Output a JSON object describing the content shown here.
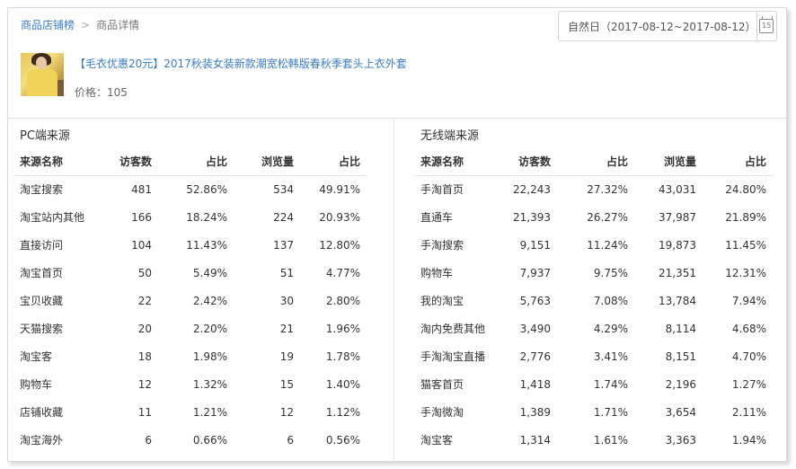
{
  "breadcrumb": {
    "root": "商品店铺榜",
    "separator": ">",
    "current": "商品详情"
  },
  "date_filter": {
    "label": "自然日（2017-08-12~2017-08-12）",
    "icon": "calendar-icon",
    "icon_text": "15"
  },
  "product": {
    "title": "【毛衣优惠20元】2017秋装女装新款潮宽松韩版春秋季套头上衣外套",
    "price": "价格：105"
  },
  "pc": {
    "title": "PC端来源",
    "columns": [
      "来源名称",
      "访客数",
      "占比",
      "浏览量",
      "占比"
    ],
    "rows": [
      [
        "淘宝搜索",
        "481",
        "52.86%",
        "534",
        "49.91%"
      ],
      [
        "淘宝站内其他",
        "166",
        "18.24%",
        "224",
        "20.93%"
      ],
      [
        "直接访问",
        "104",
        "11.43%",
        "137",
        "12.80%"
      ],
      [
        "淘宝首页",
        "50",
        "5.49%",
        "51",
        "4.77%"
      ],
      [
        "宝贝收藏",
        "22",
        "2.42%",
        "30",
        "2.80%"
      ],
      [
        "天猫搜索",
        "20",
        "2.20%",
        "21",
        "1.96%"
      ],
      [
        "淘宝客",
        "18",
        "1.98%",
        "19",
        "1.78%"
      ],
      [
        "购物车",
        "12",
        "1.32%",
        "15",
        "1.40%"
      ],
      [
        "店铺收藏",
        "11",
        "1.21%",
        "12",
        "1.12%"
      ],
      [
        "淘宝海外",
        "6",
        "0.66%",
        "6",
        "0.56%"
      ]
    ]
  },
  "wireless": {
    "title": "无线端来源",
    "columns": [
      "来源名称",
      "访客数",
      "占比",
      "浏览量",
      "占比"
    ],
    "rows": [
      [
        "手淘首页",
        "22,243",
        "27.32%",
        "43,031",
        "24.80%"
      ],
      [
        "直通车",
        "21,393",
        "26.27%",
        "37,987",
        "21.89%"
      ],
      [
        "手淘搜索",
        "9,151",
        "11.24%",
        "19,873",
        "11.45%"
      ],
      [
        "购物车",
        "7,937",
        "9.75%",
        "21,351",
        "12.31%"
      ],
      [
        "我的淘宝",
        "5,763",
        "7.08%",
        "13,784",
        "7.94%"
      ],
      [
        "淘内免费其他",
        "3,490",
        "4.29%",
        "8,114",
        "4.68%"
      ],
      [
        "手淘淘宝直播",
        "2,776",
        "3.41%",
        "8,151",
        "4.70%"
      ],
      [
        "猫客首页",
        "1,418",
        "1.74%",
        "2,196",
        "1.27%"
      ],
      [
        "手淘微淘",
        "1,389",
        "1.71%",
        "3,654",
        "2.11%"
      ],
      [
        "淘宝客",
        "1,314",
        "1.61%",
        "3,363",
        "1.94%"
      ]
    ]
  }
}
